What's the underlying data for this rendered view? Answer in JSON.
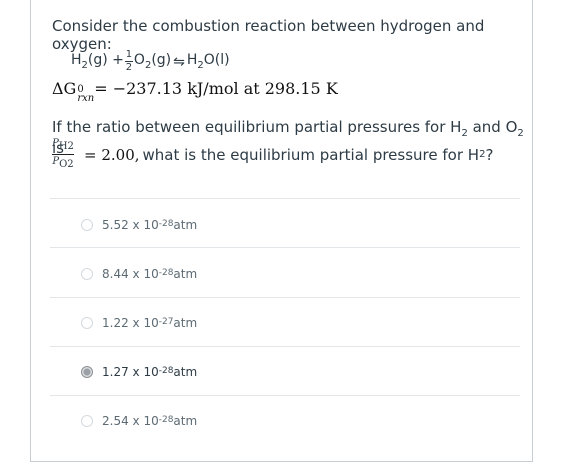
{
  "question": {
    "intro": "Consider the combustion reaction between hydrogen and oxygen:",
    "reaction": {
      "h2": "H",
      "h2_sub": "2",
      "h2_state": "(g) + ",
      "half_num": "1",
      "half_den": "2",
      "o2": "O",
      "o2_sub": "2",
      "o2_state": "(g)",
      "arrow": "⇋",
      "product": "H",
      "product_sub": "2",
      "product_rest": "O(l)"
    },
    "delta_g": {
      "symbol": "ΔG",
      "superscript": "0",
      "subscript": "rxn",
      "value": " = −237.13 kJ/mol at 298.15 K"
    },
    "ratio_line1_a": "If the ratio between equilibrium partial pressures for H",
    "ratio_line1_sub1": "2",
    "ratio_line1_b": " and O",
    "ratio_line1_sub2": "2",
    "ratio_line1_c": " is",
    "ratio_num": "P",
    "ratio_num_sub": "H2",
    "ratio_den": "P",
    "ratio_den_sub": "O2",
    "ratio_value": "= 2.00,",
    "ratio_line2_a": " what is the equilibrium partial pressure for H",
    "ratio_line2_sub": "2",
    "ratio_line2_b": "?"
  },
  "options": [
    {
      "mantissa": "5.52 x 10",
      "exponent": "-28",
      "unit": " atm",
      "selected": false
    },
    {
      "mantissa": "8.44 x 10",
      "exponent": "-28",
      "unit": " atm",
      "selected": false
    },
    {
      "mantissa": "1.22 x 10",
      "exponent": "-27",
      "unit": " atm",
      "selected": false
    },
    {
      "mantissa": "1.27 x 10",
      "exponent": "-28",
      "unit": " atm",
      "selected": true
    },
    {
      "mantissa": "2.54 x 10",
      "exponent": "-28",
      "unit": " atm",
      "selected": false
    }
  ]
}
